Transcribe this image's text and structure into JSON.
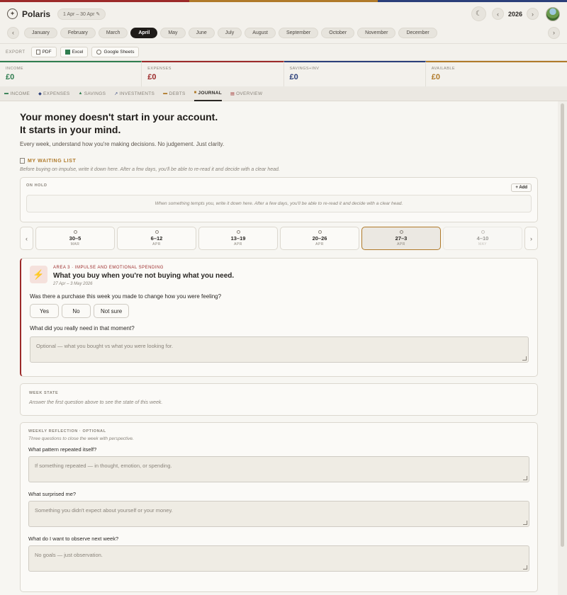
{
  "colors": {
    "accent_bar": [
      "#9c2a2a",
      "#b07a2a",
      "#2b3f7a"
    ],
    "income": "#2f7d4f",
    "expenses": "#9c2a2a",
    "savings": "#2b3f7a",
    "available": "#b07a2a"
  },
  "app": {
    "title": "Polaris",
    "range": "1 Apr – 30 Apr ✎",
    "year": "2026"
  },
  "months": [
    "January",
    "February",
    "March",
    "April",
    "May",
    "June",
    "July",
    "August",
    "September",
    "October",
    "November",
    "December"
  ],
  "selected_month": "April",
  "export": {
    "label": "EXPORT",
    "pdf": "PDF",
    "excel": "Excel",
    "sheets": "Google Sheets"
  },
  "totals": [
    {
      "label": "INCOME",
      "value": "£0"
    },
    {
      "label": "EXPENSES",
      "value": "£0"
    },
    {
      "label": "SAVINGS+INV",
      "value": "£0"
    },
    {
      "label": "AVAILABLE",
      "value": "£0"
    }
  ],
  "tabs": [
    {
      "label": "INCOME",
      "icon": "income-icon"
    },
    {
      "label": "EXPENSES",
      "icon": "expenses-icon"
    },
    {
      "label": "SAVINGS",
      "icon": "savings-icon"
    },
    {
      "label": "INVESTMENTS",
      "icon": "investments-icon"
    },
    {
      "label": "DEBTS",
      "icon": "debts-icon"
    },
    {
      "label": "JOURNAL",
      "icon": "journal-icon"
    },
    {
      "label": "OVERVIEW",
      "icon": "overview-icon"
    }
  ],
  "active_tab": "JOURNAL",
  "journal": {
    "headline_1": "Your money doesn't start in your account.",
    "headline_2": "It starts in your mind.",
    "lead": "Every week, understand how you're making decisions. No judgement. Just clarity.",
    "waiting_title": "MY WAITING LIST",
    "waiting_sub": "Before buying on impulse, write it down here. After a few days, you'll be able to re-read it and decide with a clear head.",
    "on_hold_label": "ON HOLD",
    "add_label": "+ Add",
    "empty_text": "When something tempts you, write it down here. After a few days, you'll be able to re-read it and decide with a clear head."
  },
  "weeks": [
    {
      "range": "30–5",
      "month": "MAR"
    },
    {
      "range": "6–12",
      "month": "APR"
    },
    {
      "range": "13–19",
      "month": "APR"
    },
    {
      "range": "20–26",
      "month": "APR"
    },
    {
      "range": "27–3",
      "month": "APR"
    },
    {
      "range": "4–10",
      "month": "MAY"
    }
  ],
  "selected_week": "27–3",
  "area": {
    "tag": "AREA 3 · IMPULSE AND EMOTIONAL SPENDING",
    "title": "What you buy when you're not buying what you need.",
    "dates": "27 Apr – 3 May 2026",
    "question_1": "Was there a purchase this week you made to change how you were feeling?",
    "choices": [
      "Yes",
      "No",
      "Not sure"
    ],
    "question_2": "What did you really need in that moment?",
    "placeholder": "Optional — what you bought vs what you were looking for."
  },
  "week_state": {
    "label": "WEEK STATE",
    "text": "Answer the first question above to see the state of this week."
  },
  "reflection": {
    "label": "WEEKLY REFLECTION · OPTIONAL",
    "sub": "Three questions to close the week with perspective.",
    "q1": "What pattern repeated itself?",
    "p1": "If something repeated — in thought, emotion, or spending.",
    "q2": "What surprised me?",
    "p2": "Something you didn't expect about yourself or your money.",
    "q3": "What do I want to observe next week?",
    "p3": "No goals — just observation."
  }
}
